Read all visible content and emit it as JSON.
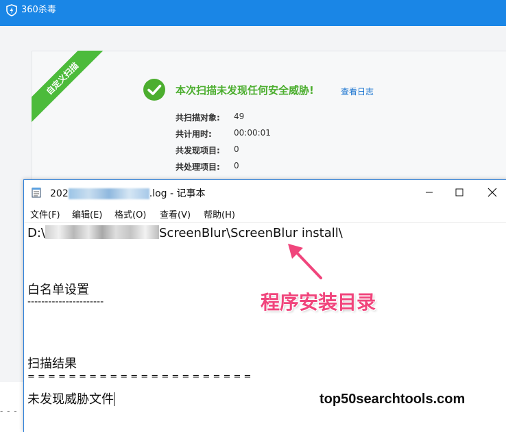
{
  "app": {
    "title": "360杀毒",
    "logo_icon": "shield-lightning-icon",
    "brand_color": "#1a86e6"
  },
  "scan_result": {
    "ribbon": "自定义扫描",
    "status_icon": "check-circle-icon",
    "title": "本次扫描未发现任何安全威胁!",
    "view_log": "查看日志",
    "stats": [
      {
        "label": "共扫描对象:",
        "value": "49"
      },
      {
        "label": "共计用时:",
        "value": "00:00:01"
      },
      {
        "label": "共发现项目:",
        "value": "0"
      },
      {
        "label": "共处理项目:",
        "value": "0"
      }
    ],
    "success_color": "#4cae2f"
  },
  "notepad": {
    "title_prefix": "202",
    "title_suffix": ".log - 记事本",
    "menu": [
      "文件(F)",
      "编辑(E)",
      "格式(O)",
      "查看(V)",
      "帮助(H)"
    ],
    "lines": {
      "path_prefix": "D:\\",
      "path_suffix": "ScreenBlur\\ScreenBlur install\\",
      "whitelist_heading": "白名单设置",
      "whitelist_rule": "----------------------",
      "result_heading": "扫描结果",
      "result_rule": "= = = = = = = = = = = = = = = = = = = = = =",
      "result_text": "未发现威胁文件"
    }
  },
  "annotation": {
    "text": "程序安装目录",
    "color": "#f0457c"
  },
  "watermark": "top50searchtools.com",
  "bottom_dashes": "- - -"
}
